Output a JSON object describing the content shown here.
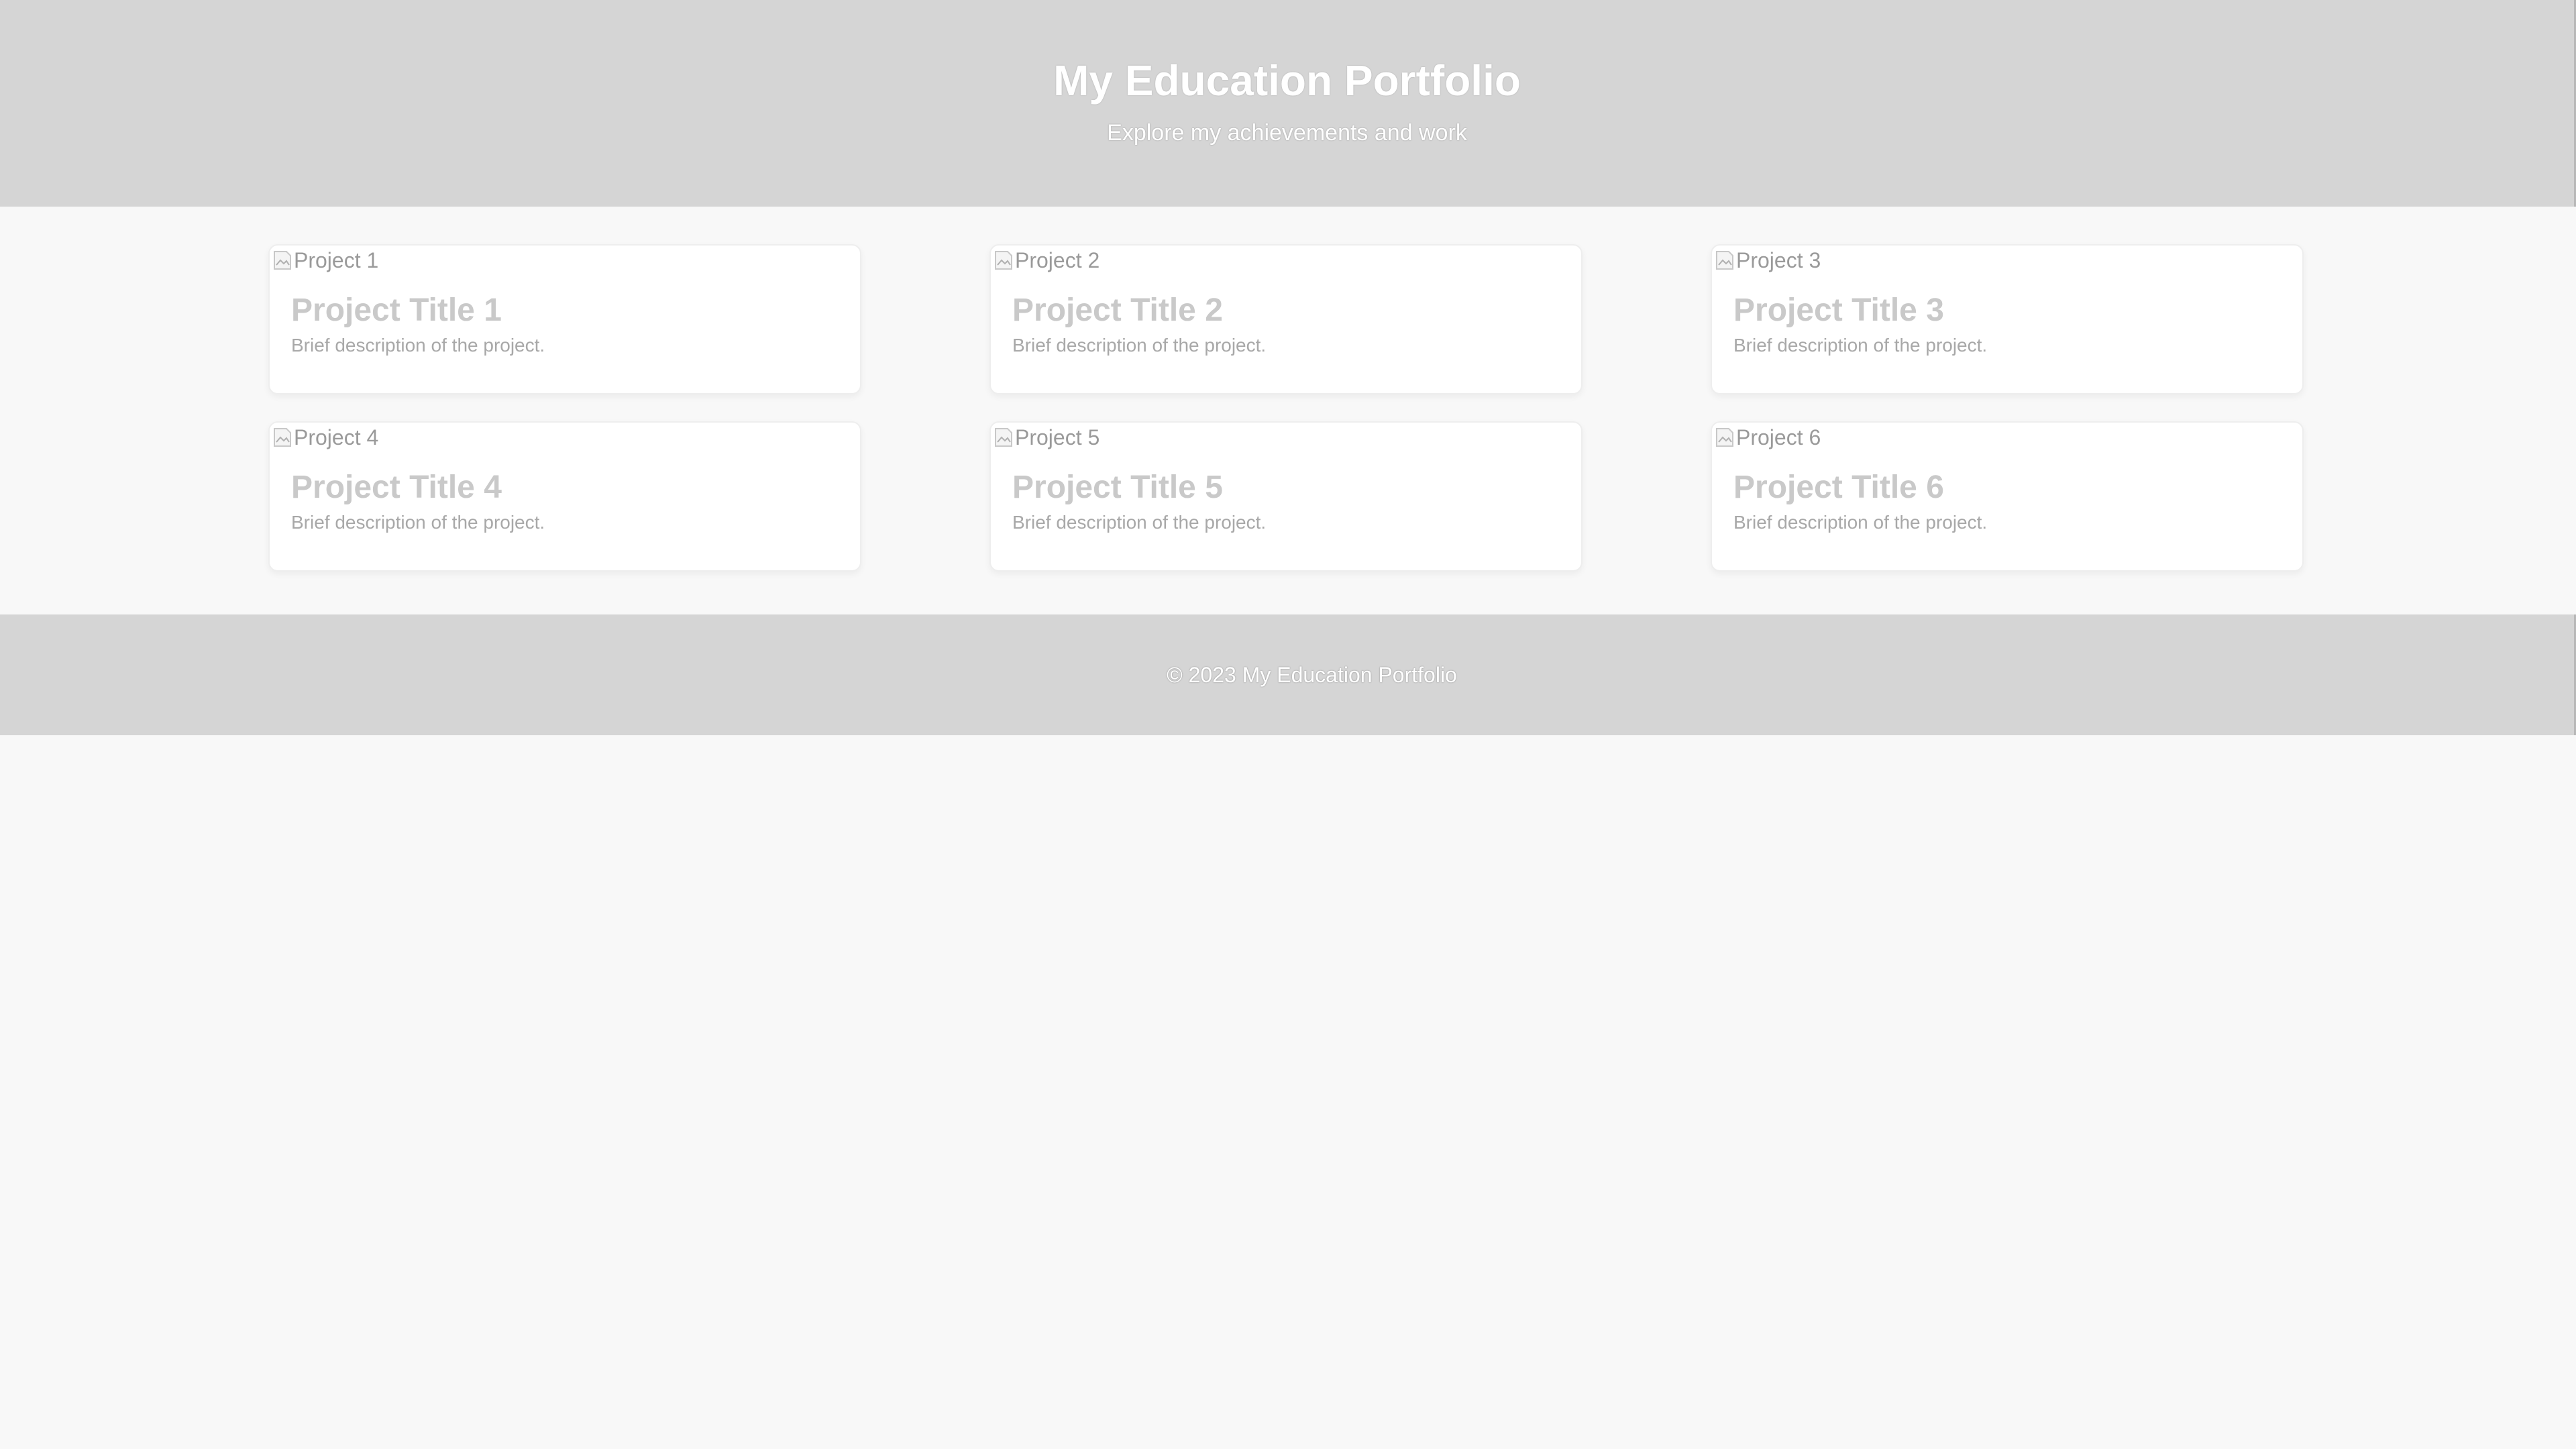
{
  "header": {
    "title": "My Education Portfolio",
    "subtitle": "Explore my achievements and work"
  },
  "projects": [
    {
      "image_alt": "Project 1",
      "title": "Project Title 1",
      "description": "Brief description of the project."
    },
    {
      "image_alt": "Project 2",
      "title": "Project Title 2",
      "description": "Brief description of the project."
    },
    {
      "image_alt": "Project 3",
      "title": "Project Title 3",
      "description": "Brief description of the project."
    },
    {
      "image_alt": "Project 4",
      "title": "Project Title 4",
      "description": "Brief description of the project."
    },
    {
      "image_alt": "Project 5",
      "title": "Project Title 5",
      "description": "Brief description of the project."
    },
    {
      "image_alt": "Project 6",
      "title": "Project Title 6",
      "description": "Brief description of the project."
    }
  ],
  "footer": {
    "copyright": "© 2023 My Education Portfolio"
  },
  "icons": {
    "project_image": "broken-image-icon"
  },
  "colors": {
    "header_background": "#d5d5d5",
    "page_background": "#f8f8f8",
    "card_background": "#ffffff"
  }
}
